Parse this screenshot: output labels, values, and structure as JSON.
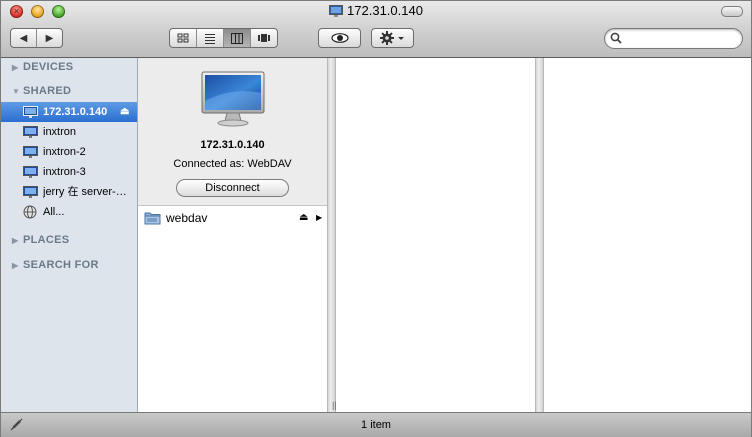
{
  "window": {
    "title": "172.31.0.140"
  },
  "toolbar": {
    "back_label": "◀",
    "forward_label": "▶",
    "view_modes": [
      "icon-view",
      "list-view",
      "column-view",
      "coverflow-view"
    ],
    "active_view": "column-view",
    "search_placeholder": ""
  },
  "sidebar": {
    "devices_label": "DEVICES",
    "shared_label": "SHARED",
    "places_label": "PLACES",
    "search_for_label": "SEARCH FOR",
    "shared_items": [
      {
        "label": "172.31.0.140",
        "icon": "monitor-icon",
        "selected": true
      },
      {
        "label": "inxtron",
        "icon": "monitor-icon"
      },
      {
        "label": "inxtron-2",
        "icon": "monitor-icon"
      },
      {
        "label": "inxtron-3",
        "icon": "monitor-icon"
      },
      {
        "label": "jerry 在 server-gen",
        "icon": "monitor-icon"
      },
      {
        "label": "All...",
        "icon": "network-globe-icon"
      }
    ]
  },
  "info": {
    "server_name": "172.31.0.140",
    "connected_as": "Connected as: WebDAV",
    "disconnect_label": "Disconnect"
  },
  "files": [
    {
      "name": "webdav",
      "icon": "shared-folder-icon"
    }
  ],
  "status": {
    "text": "1 item"
  },
  "colors": {
    "selection": "#2a6fd1",
    "sidebar_bg": "#dde4ec",
    "info_bg": "#ececec"
  }
}
